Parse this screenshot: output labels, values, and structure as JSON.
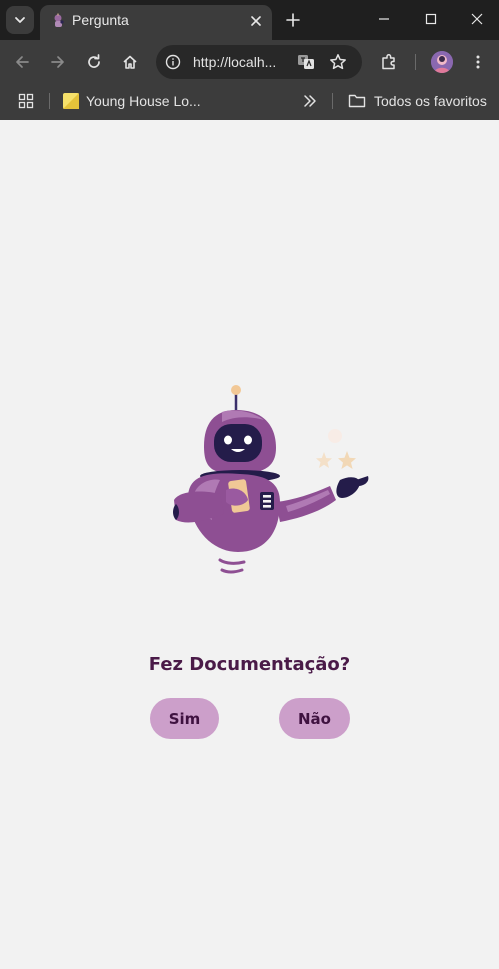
{
  "browser": {
    "tab": {
      "title": "Pergunta"
    },
    "omnibox": {
      "url": "http://localh..."
    },
    "bookmarks": {
      "items": [
        {
          "label": "Young House Lo..."
        }
      ],
      "all_bookmarks_label": "Todos os favoritos"
    }
  },
  "page": {
    "question": "Fez Documentação?",
    "buttons": {
      "yes_label": "Sim",
      "no_label": "Não"
    },
    "colors": {
      "background": "#f2f2f2",
      "question_text": "#4a1a48",
      "button_bg": "#cc9fca",
      "button_text": "#3f1240",
      "robot_purple": "#8e4f93",
      "robot_dark": "#241c4a"
    }
  }
}
